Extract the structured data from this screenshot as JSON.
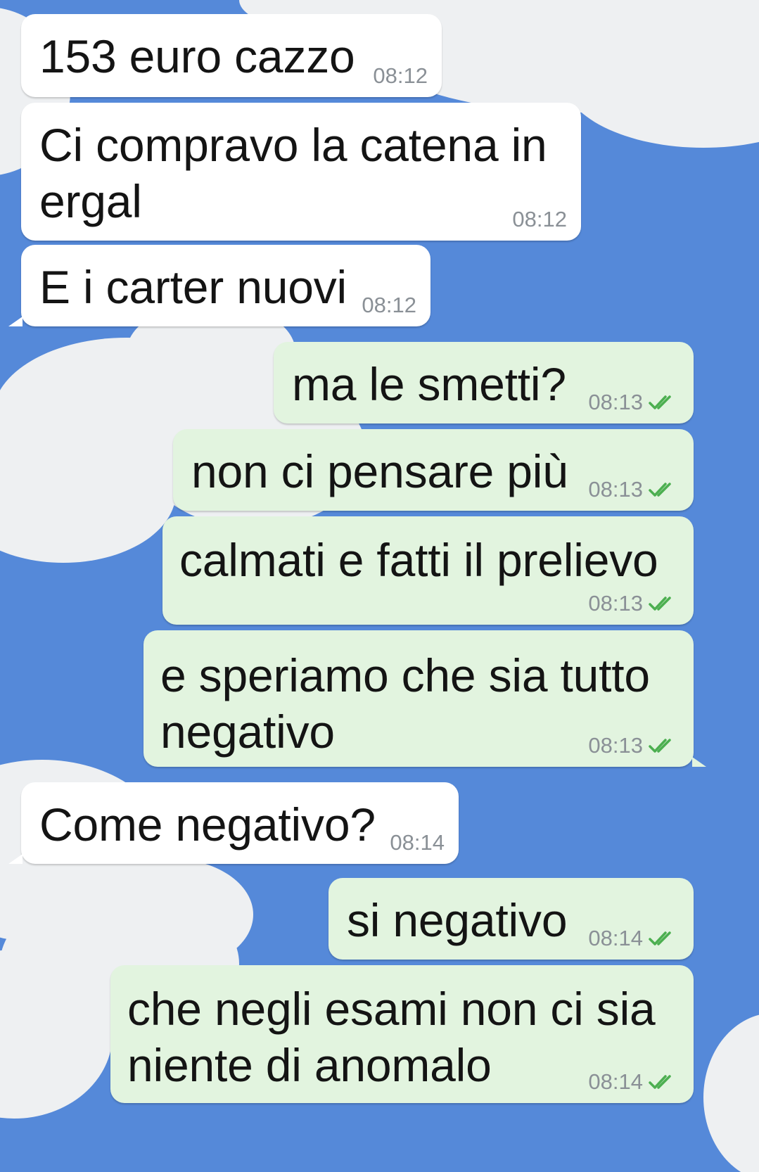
{
  "colors": {
    "wallpaper": "#5589d9",
    "cloud": "#eef0f2",
    "incoming_bubble": "#ffffff",
    "outgoing_bubble": "#e2f4df",
    "read_check": "#4caf50",
    "timestamp": "#8a9096"
  },
  "messages": [
    {
      "direction": "incoming",
      "text": "153 euro cazzo",
      "time": "08:12"
    },
    {
      "direction": "incoming",
      "text": "Ci compravo la catena in\nergal",
      "time": "08:12"
    },
    {
      "direction": "incoming",
      "text": "E i carter nuovi",
      "time": "08:12"
    },
    {
      "direction": "outgoing",
      "text": "ma le smetti?",
      "time": "08:13",
      "status_icon": "double-check-icon"
    },
    {
      "direction": "outgoing",
      "text": "non ci pensare più",
      "time": "08:13",
      "status_icon": "double-check-icon"
    },
    {
      "direction": "outgoing",
      "text": "calmati e fatti il prelievo",
      "time": "08:13",
      "status_icon": "double-check-icon"
    },
    {
      "direction": "outgoing",
      "text": "e speriamo che sia tutto\nnegativo",
      "time": "08:13",
      "status_icon": "double-check-icon"
    },
    {
      "direction": "incoming",
      "text": "Come negativo?",
      "time": "08:14"
    },
    {
      "direction": "outgoing",
      "text": "si negativo",
      "time": "08:14",
      "status_icon": "double-check-icon"
    },
    {
      "direction": "outgoing",
      "text": "che negli esami non ci sia\nniente di anomalo",
      "time": "08:14",
      "status_icon": "double-check-icon"
    }
  ]
}
